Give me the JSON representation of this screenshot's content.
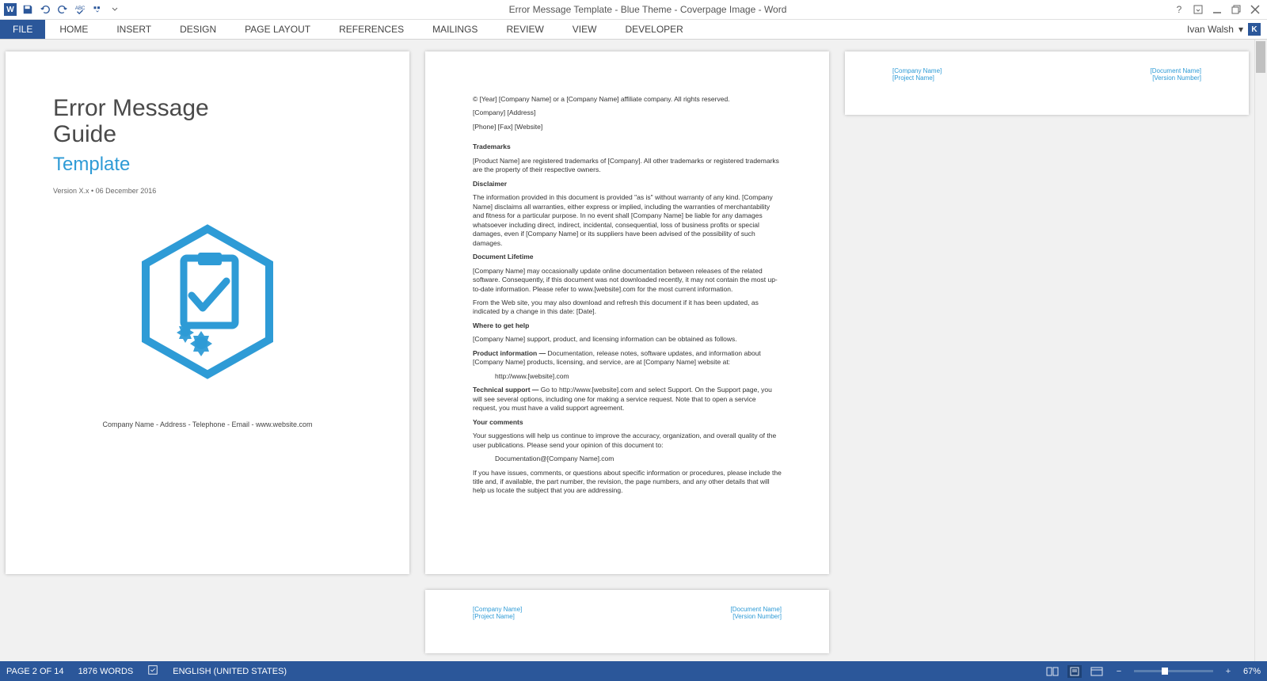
{
  "titlebar": {
    "title": "Error Message Template - Blue Theme - Coverpage Image - Word"
  },
  "ribbon": {
    "file": "FILE",
    "tabs": [
      "HOME",
      "INSERT",
      "DESIGN",
      "PAGE LAYOUT",
      "REFERENCES",
      "MAILINGS",
      "REVIEW",
      "VIEW",
      "DEVELOPER"
    ]
  },
  "user": {
    "name": "Ivan Walsh",
    "initial": "K"
  },
  "cover": {
    "title1": "Error Message",
    "title2": "Guide",
    "subtitle": "Template",
    "version": "Version X.x • 06 December 2016",
    "footer": "Company Name - Address - Telephone - Email - www.website.com"
  },
  "legal": {
    "copyright": "© [Year] [Company Name] or a [Company Name] affiliate company. All rights reserved.",
    "addr": "[Company] [Address]",
    "contact": "[Phone] [Fax] [Website]",
    "trademarks_h": "Trademarks",
    "trademarks": "[Product Name] are registered trademarks of [Company]. All other trademarks or registered trademarks are the property of their respective owners.",
    "disclaimer_h": "Disclaimer",
    "disclaimer": "The information provided in this document is provided \"as is\" without warranty of any kind. [Company Name] disclaims all warranties, either express or implied, including the warranties of merchantability and fitness for a particular purpose. In no event shall [Company Name] be liable for any damages whatsoever including direct, indirect, incidental, consequential, loss of business profits or special damages, even if [Company Name] or its suppliers have been advised of the possibility of such damages.",
    "lifetime_h": "Document Lifetime",
    "lifetime1": "[Company Name] may occasionally update online documentation between releases of the related software. Consequently, if this document was not downloaded recently, it may not contain the most up-to-date information. Please refer to www.[website].com for the most current information.",
    "lifetime2": "From the Web site, you may also download and refresh this document if it has been updated, as indicated by a change in this date: [Date].",
    "help_h": "Where to get help",
    "help1": "[Company Name] support, product, and licensing information can be obtained as follows.",
    "prodinfo_lead": "Product information — ",
    "prodinfo": "Documentation, release notes, software updates, and information about [Company Name] products, licensing, and service, are at [Company Name] website at:",
    "url1": "http://www.[website].com",
    "tech_lead": "Technical support — ",
    "tech": "Go to http://www.[website].com and select Support. On the Support page, you will see several options, including one for making a service request. Note that to open a service request, you must have a valid support agreement.",
    "comments_h": "Your comments",
    "comments1": "Your suggestions will help us continue to improve the accuracy, organization, and overall quality of the user publications. Please send your opinion of this document to:",
    "email": "Documentation@[Company Name].com",
    "comments2": "If you have issues, comments, or questions about specific information or procedures, please include the title and, if available, the part number, the revision, the page numbers, and any other details that will help us locate the subject that you are addressing."
  },
  "footerpage": {
    "l1": "[Company Name]",
    "l2": "[Project Name]",
    "r1": "[Document Name]",
    "r2": "[Version Number]"
  },
  "status": {
    "page": "PAGE 2 OF 14",
    "words": "1876 WORDS",
    "lang": "ENGLISH (UNITED STATES)",
    "zoom": "67%"
  }
}
